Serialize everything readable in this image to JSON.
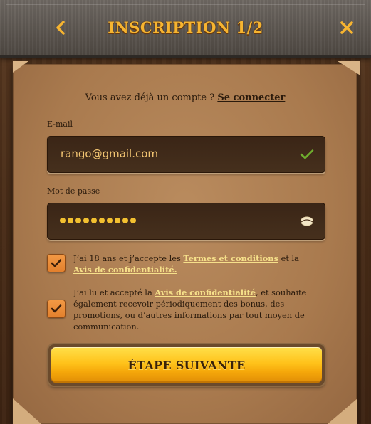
{
  "header": {
    "title": "INSCRIPTION 1/2",
    "back_icon": "chevron-left-icon",
    "close_icon": "close-icon"
  },
  "login_prompt": {
    "text": "Vous avez déjà un compte ? ",
    "link": "Se connecter"
  },
  "email": {
    "label": "E-mail",
    "value": "rango@gmail.com",
    "status_icon": "check-icon"
  },
  "password": {
    "label": "Mot de passe",
    "mask_length": 10,
    "toggle_icon": "eye-icon"
  },
  "consent_terms": {
    "checked": true,
    "text_1": "J’ai 18 ans et j’accepte les ",
    "link_1": "Termes et conditions",
    "text_2": " et la ",
    "link_2": "Avis de confidentialité."
  },
  "consent_marketing": {
    "checked": true,
    "text_1": "J’ai lu et accepté la ",
    "link_1": "Avis de confidentialité",
    "text_2": ", et souhaite également recevoir périodiquement des bonus, des promotions, ou d’autres informations par tout moyen de communication."
  },
  "next_button": {
    "label": "ÉTAPE SUIVANTE"
  },
  "colors": {
    "title_gold": "#f6b430",
    "button_yellow": "#ffc21a",
    "checkbox_orange": "#f39a45",
    "link_yellow": "#f6e08a"
  }
}
